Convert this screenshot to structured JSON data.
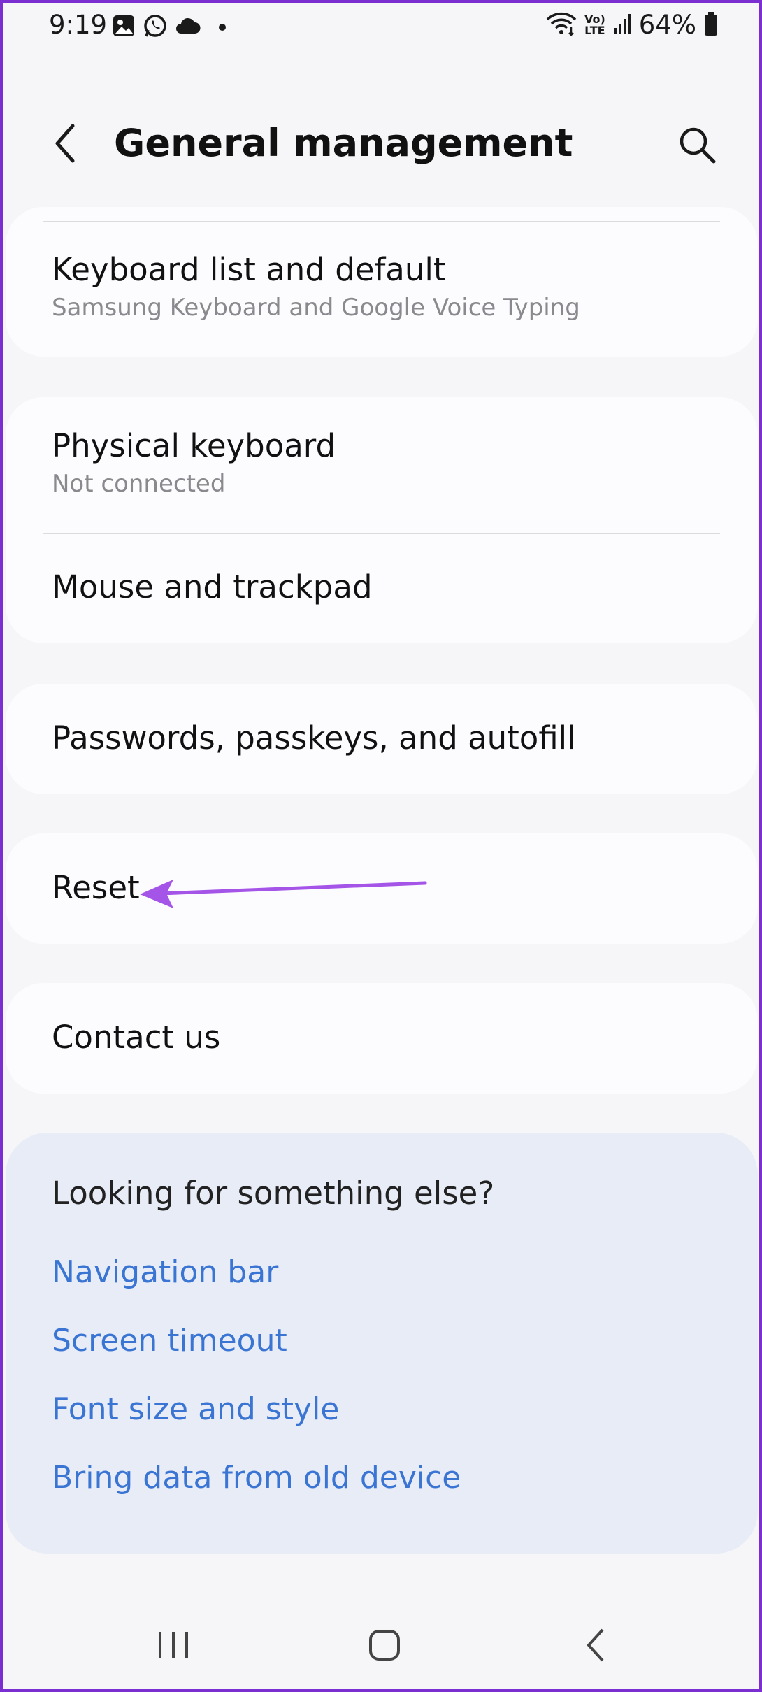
{
  "status_bar": {
    "time": "9:19",
    "left_icons": [
      "gallery-icon",
      "whatsapp-icon",
      "cloud-icon",
      "dot-icon"
    ],
    "right_icons": [
      "wifi-icon",
      "volte-icon",
      "signal-icon",
      "battery-icon"
    ],
    "volte_label_top": "Vo)",
    "volte_label_bottom": "LTE",
    "battery": "64%"
  },
  "header": {
    "title": "General management"
  },
  "items": {
    "keyboard_list": {
      "title": "Keyboard list and default",
      "subtitle": "Samsung Keyboard and Google Voice Typing"
    },
    "physical_keyboard": {
      "title": "Physical keyboard",
      "subtitle": "Not connected"
    },
    "mouse_trackpad": {
      "title": "Mouse and trackpad"
    },
    "passwords": {
      "title": "Passwords, passkeys, and autofill"
    },
    "reset": {
      "title": "Reset"
    },
    "contact_us": {
      "title": "Contact us"
    }
  },
  "suggestions": {
    "heading": "Looking for something else?",
    "links": [
      "Navigation bar",
      "Screen timeout",
      "Font size and style",
      "Bring data from old device"
    ]
  },
  "colors": {
    "accent_link": "#3a75d4",
    "annotation_arrow": "#a455e8",
    "frame": "#7b2fd0"
  }
}
